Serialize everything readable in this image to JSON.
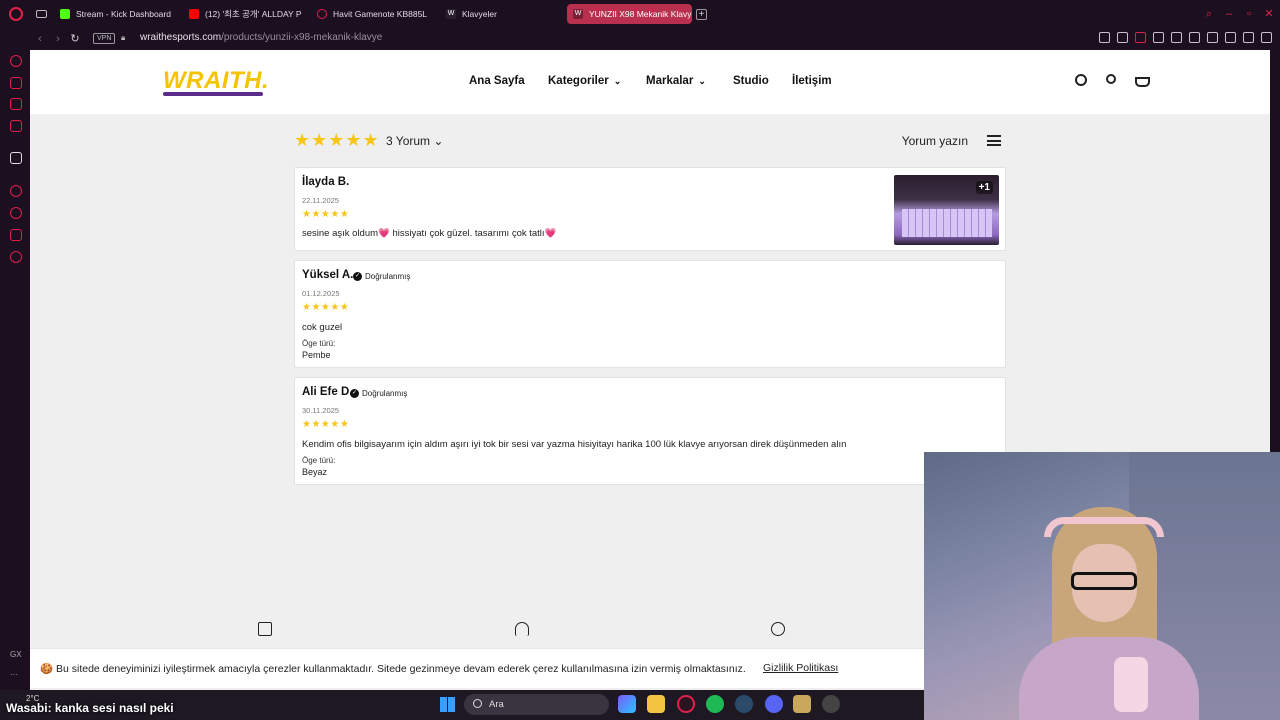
{
  "browser": {
    "tabs": [
      {
        "label": "Stream - Kick Dashboard",
        "color": "#53fc18"
      },
      {
        "label": "(12) '최초 공개' ALLDAY P",
        "color": "#ff0000"
      },
      {
        "label": "Havit Gamenote KB885L",
        "color": "#e0204a"
      },
      {
        "label": "Klavyeler",
        "color": "#ffffff"
      },
      {
        "label": "YUNZII X98 Mekanik Klavy",
        "color": "#ffffff"
      }
    ],
    "vpn_label": "VPN",
    "url_domain": "wraithesports.com",
    "url_path": "/products/yunzii-x98-mekanik-klavye"
  },
  "site": {
    "logo": "WRAITH.",
    "nav": [
      {
        "label": "Ana Sayfa"
      },
      {
        "label": "Kategoriler",
        "dropdown": true
      },
      {
        "label": "Markalar",
        "dropdown": true
      },
      {
        "label": "Studio"
      },
      {
        "label": "İletişim"
      }
    ]
  },
  "reviews": {
    "rating_stars": "★★★★★",
    "count_label": "3 Yorum",
    "write_label": "Yorum yazın",
    "items": [
      {
        "name": "İlayda B.",
        "verified": "",
        "date": "22.11.2025",
        "stars": "★★★★★",
        "text": "sesine aşık oldum💗 hissiyatı çok güzel. tasarımı çok tatlı💗",
        "photo_extra": "+1"
      },
      {
        "name": "Yüksel A.",
        "verified": "Doğrulanmış",
        "date": "01.12.2025",
        "stars": "★★★★★",
        "text": "cok guzel",
        "variant_label": "Öge türü:",
        "variant": "Pembe"
      },
      {
        "name": "Ali Efe D.",
        "verified": "Doğrulanmış",
        "date": "30.11.2025",
        "stars": "★★★★★",
        "text": "Kendim ofis bilgisayarım için aldım aşırı iyi tok bir sesi var yazma hisiyitayı harika 100 lük klavye arıyorsan direk düşünmeden alın",
        "variant_label": "Öge türü:",
        "variant": "Beyaz"
      }
    ]
  },
  "cookie": {
    "text": "🍪 Bu sitede deneyiminizi iyileştirmek amacıyla çerezler kullanmaktadır. Sitede gezinmeye devam ederek çerez kullanılmasına izin vermiş olmaktasınız.",
    "link": "Gizlilik Politikası"
  },
  "taskbar": {
    "weather": "2°C",
    "search_label": "Ara",
    "overlay_text": "Wasabi: kanka sesi nasıl peki"
  },
  "sidebar": {
    "bottom_label": "GX"
  }
}
